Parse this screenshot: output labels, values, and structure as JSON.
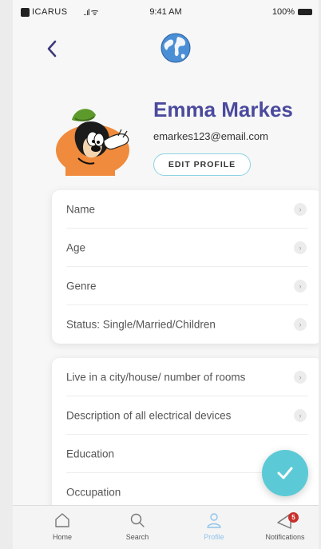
{
  "status_bar": {
    "carrier": "ICARUS",
    "signal": "..ıl ᯤ",
    "time": "9:41 AM",
    "battery": "100%"
  },
  "header": {
    "back_icon": "chevron-left-icon",
    "logo_icon": "globe-icon"
  },
  "profile": {
    "name": "Emma Markes",
    "email": "emarkes123@email.com",
    "edit_label": "EDIT PROFILE"
  },
  "card1": {
    "items": [
      {
        "label": "Name"
      },
      {
        "label": "Age"
      },
      {
        "label": "Genre"
      },
      {
        "label": "Status: Single/Married/Children"
      }
    ]
  },
  "card2": {
    "items": [
      {
        "label": "Live in a city/house/ number of rooms"
      },
      {
        "label": "Description of all electrical devices"
      },
      {
        "label": "Education"
      },
      {
        "label": "Occupation"
      }
    ]
  },
  "chevron_glyph": "›",
  "tabbar": {
    "tabs": [
      {
        "label": "Home",
        "icon": "home-icon"
      },
      {
        "label": "Search",
        "icon": "search-icon"
      },
      {
        "label": "Profile",
        "icon": "user-icon",
        "active": true
      },
      {
        "label": "Notifications",
        "icon": "bell-icon",
        "badge": "5"
      }
    ]
  },
  "colors": {
    "accent": "#4b4a9e",
    "teal": "#5ccad6",
    "active_tab": "#8fc4ea",
    "badge": "#c8302c"
  }
}
